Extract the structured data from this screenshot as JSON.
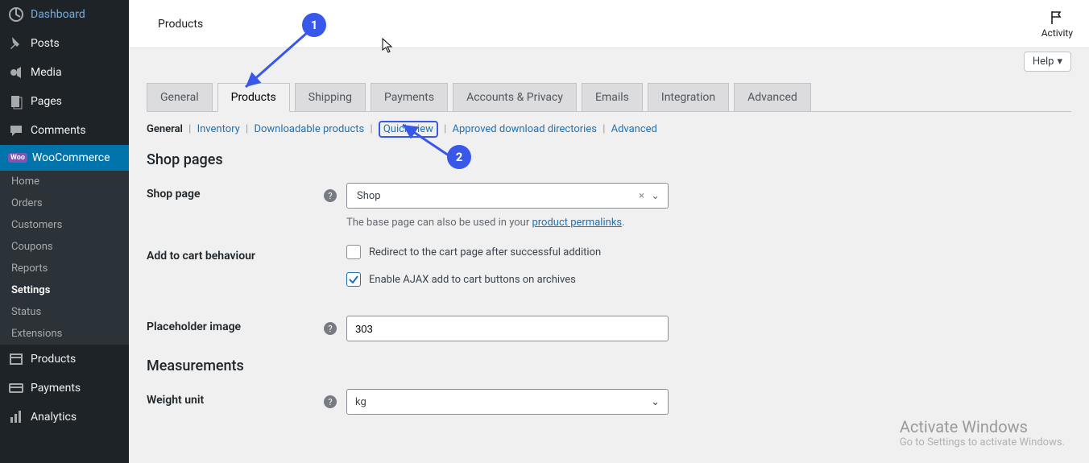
{
  "sidebar": {
    "dashboard": "Dashboard",
    "posts": "Posts",
    "media": "Media",
    "pages": "Pages",
    "comments": "Comments",
    "woocommerce": "WooCommerce",
    "woo_badge": "Woo",
    "sub": {
      "home": "Home",
      "orders": "Orders",
      "customers": "Customers",
      "coupons": "Coupons",
      "reports": "Reports",
      "settings": "Settings",
      "status": "Status",
      "extensions": "Extensions"
    },
    "products": "Products",
    "payments": "Payments",
    "analytics": "Analytics"
  },
  "topbar": {
    "title": "Products",
    "activity": "Activity"
  },
  "help": {
    "label": "Help"
  },
  "tabs": {
    "general": "General",
    "products": "Products",
    "shipping": "Shipping",
    "payments": "Payments",
    "accounts": "Accounts & Privacy",
    "emails": "Emails",
    "integration": "Integration",
    "advanced": "Advanced"
  },
  "subtabs": {
    "general": "General",
    "inventory": "Inventory",
    "downloadable": "Downloadable products",
    "quickview": "Quick view",
    "approved": "Approved download directories",
    "advanced": "Advanced"
  },
  "sections": {
    "shop_pages": "Shop pages",
    "shop_page_label": "Shop page",
    "shop_page_value": "Shop",
    "shop_page_hint_pre": "The base page can also be used in your ",
    "shop_page_hint_link": "product permalinks",
    "shop_page_hint_post": ".",
    "add_to_cart_label": "Add to cart behaviour",
    "cb_redirect": "Redirect to the cart page after successful addition",
    "cb_ajax": "Enable AJAX add to cart buttons on archives",
    "placeholder_label": "Placeholder image",
    "placeholder_value": "303",
    "measurements": "Measurements",
    "weight_label": "Weight unit",
    "weight_value": "kg"
  },
  "watermark": {
    "title": "Activate Windows",
    "sub": "Go to Settings to activate Windows."
  },
  "annotations": {
    "n1": "1",
    "n2": "2"
  }
}
